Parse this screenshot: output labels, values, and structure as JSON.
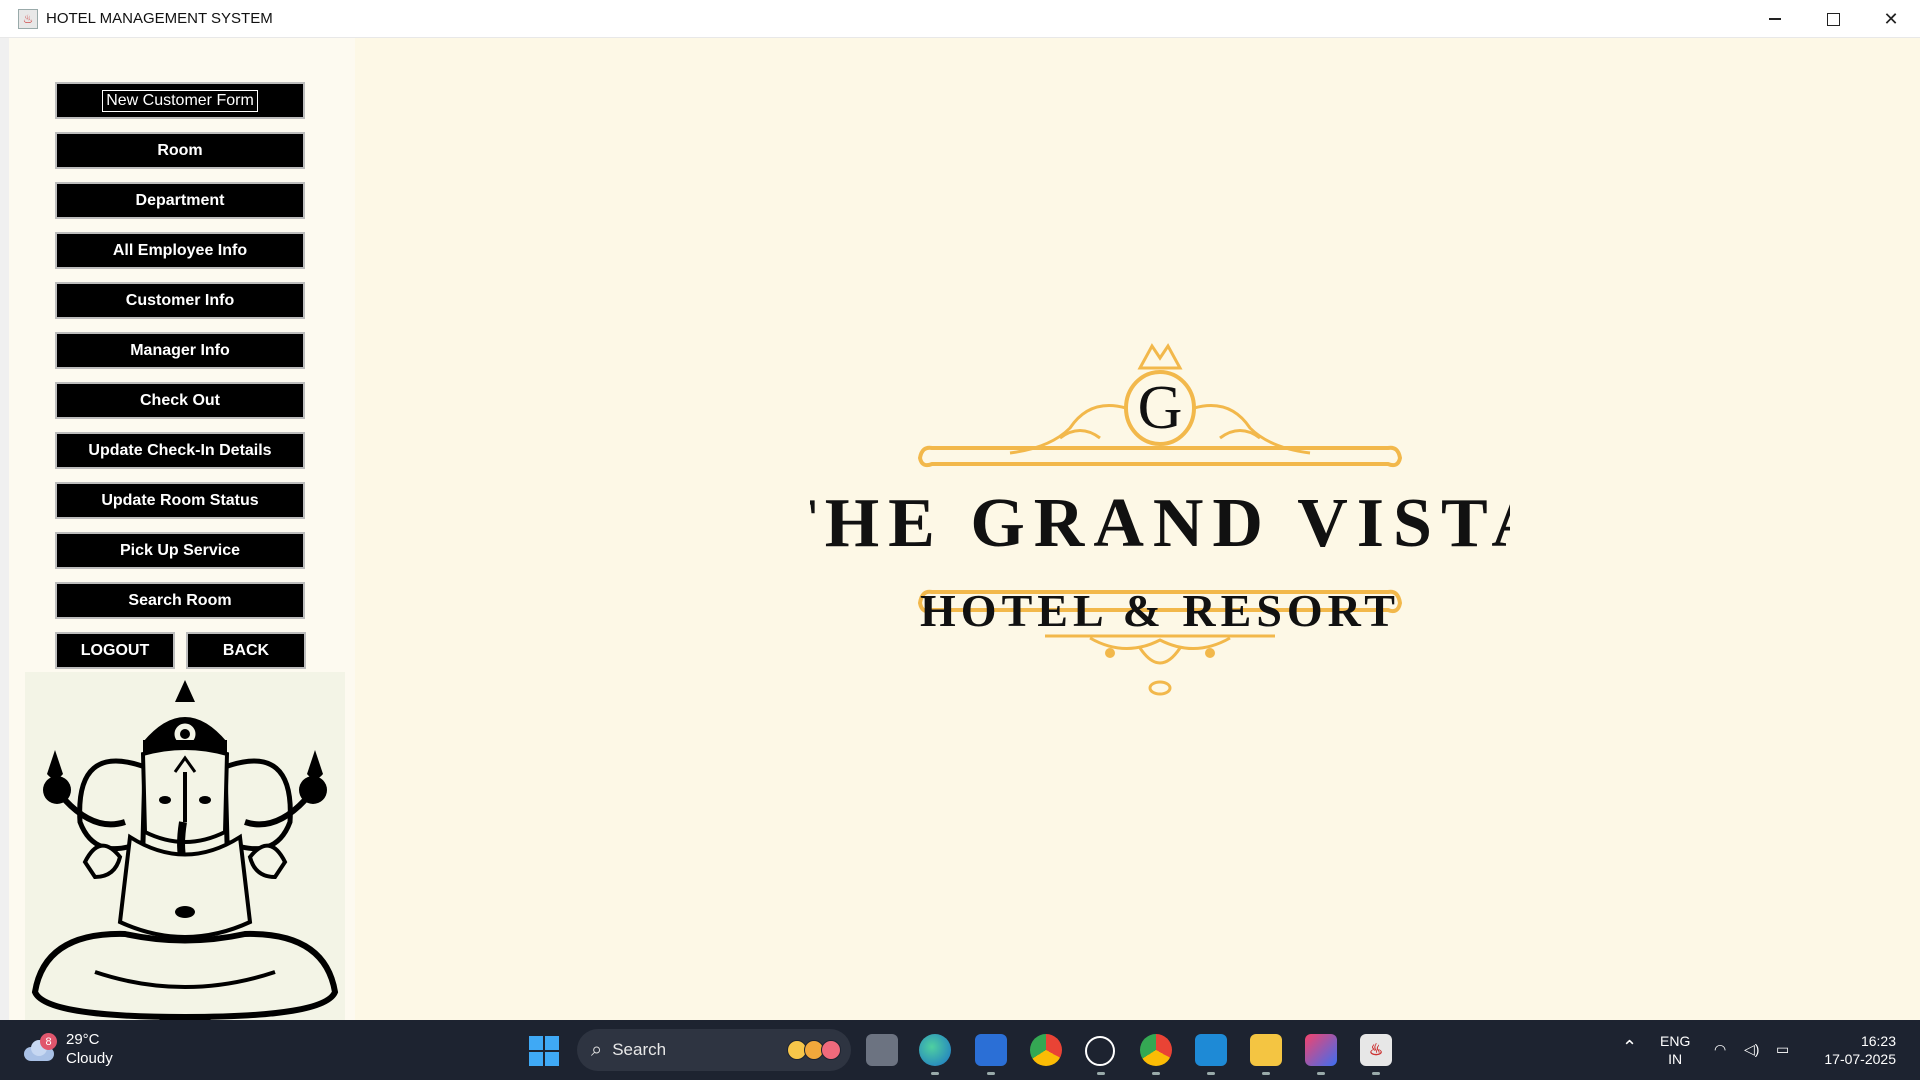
{
  "window": {
    "title": "HOTEL MANAGEMENT SYSTEM"
  },
  "sidebar": {
    "buttons": [
      "New Customer Form",
      "Room",
      "Department",
      "All Employee Info",
      "Customer Info",
      "Manager Info",
      "Check Out",
      "Update Check-In Details",
      "Update Room Status",
      "Pick Up Service",
      "Search Room"
    ],
    "logout": "LOGOUT",
    "back": "BACK"
  },
  "logo": {
    "monogram": "G",
    "name": "THE GRAND VISTA",
    "subtitle": "HOTEL & RESORT",
    "accent_color": "#f2b84b"
  },
  "taskbar": {
    "weather": {
      "temp": "29°C",
      "condition": "Cloudy",
      "badge": "8"
    },
    "search_placeholder": "Search",
    "apps": [
      "task-view-icon",
      "edge-icon",
      "store-icon",
      "chrome-icon",
      "chatgpt-icon",
      "chrome-icon",
      "vscode-icon",
      "file-explorer-icon",
      "intellij-icon",
      "java-icon"
    ],
    "language": "ENG",
    "region": "IN",
    "time": "16:23",
    "date": "17-07-2025"
  }
}
